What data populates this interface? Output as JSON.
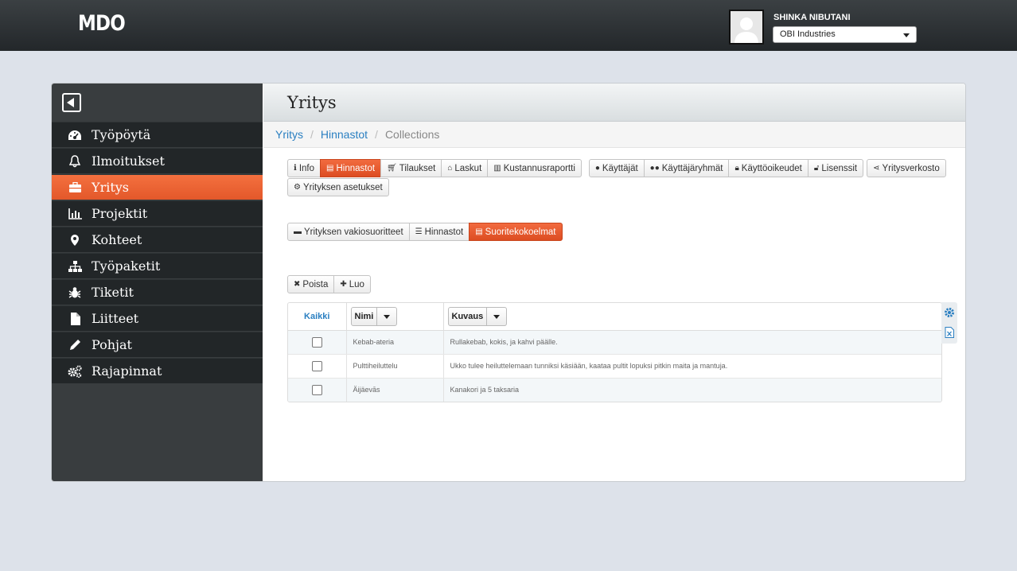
{
  "header": {
    "logo": "MDO",
    "user_name": "SHINKA NIBUTANI",
    "company": "OBI Industries"
  },
  "sidebar": {
    "items": [
      {
        "label": "Työpöytä",
        "icon": "dashboard-icon"
      },
      {
        "label": "Ilmoitukset",
        "icon": "bell-icon"
      },
      {
        "label": "Yritys",
        "icon": "briefcase-icon",
        "active": true
      },
      {
        "label": "Projektit",
        "icon": "bar-chart-icon"
      },
      {
        "label": "Kohteet",
        "icon": "map-marker-icon"
      },
      {
        "label": "Työpaketit",
        "icon": "sitemap-icon"
      },
      {
        "label": "Tiketit",
        "icon": "bug-icon"
      },
      {
        "label": "Liitteet",
        "icon": "file-icon"
      },
      {
        "label": "Pohjat",
        "icon": "pencil-icon"
      },
      {
        "label": "Rajapinnat",
        "icon": "cogs-icon"
      }
    ]
  },
  "main": {
    "title": "Yritys",
    "breadcrumb": [
      "Yritys",
      "Hinnastot",
      "Collections"
    ],
    "tabs_row1": {
      "group1": [
        "Info",
        "Hinnastot",
        "Tilaukset",
        "Laskut",
        "Kustannusraportti"
      ],
      "group2": [
        "Käyttäjät",
        "Käyttäjäryhmät",
        "Käyttöoikeudet",
        "Lisenssit"
      ],
      "group3": [
        "Yritysverkosto"
      ],
      "group4": [
        "Yrityksen asetukset"
      ]
    },
    "subtabs": [
      "Yrityksen vakiosuoritteet",
      "Hinnastot",
      "Suoritekokoelmat"
    ],
    "actions": {
      "delete": "Poista",
      "create": "Luo"
    },
    "table": {
      "all_label": "Kaikki",
      "columns": [
        "Nimi",
        "Kuvaus"
      ],
      "rows": [
        {
          "name": "Kebab-ateria",
          "description": "Rullakebab, kokis, ja kahvi päälle."
        },
        {
          "name": "Pulttiheiluttelu",
          "description": "Ukko tulee heiluttelemaan tunniksi käsiään, kaataa pultit lopuksi pitkin maita ja mantuja."
        },
        {
          "name": "Äijäevās",
          "description": "Kanakori ja 5 taksaria"
        }
      ]
    }
  },
  "colors": {
    "accent": "#e8592b",
    "link": "#2a7fc1",
    "sidebar": "#222628"
  }
}
